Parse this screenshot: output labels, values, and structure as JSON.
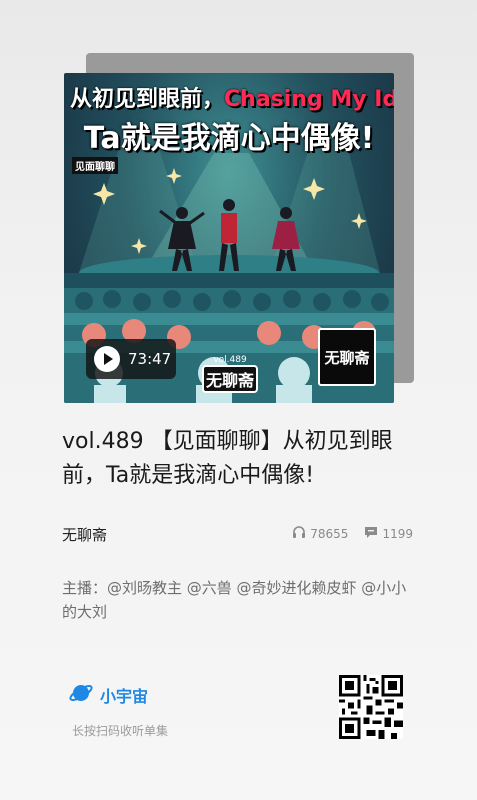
{
  "cover": {
    "title_line1_prefix": "从初见到眼前，",
    "title_line1_accent": "Chasing My Idol",
    "title_line2": "Ta就是我滴心中偶像!",
    "brand_small": "见面聊聊",
    "duration": "73:47",
    "vol_label": "vol.489",
    "vol_logo_name": "无聊斋",
    "corner_logo_name": "无聊斋"
  },
  "episode": {
    "title": "vol.489 【见面聊聊】从初见到眼前，Ta就是我滴心中偶像!",
    "show_name": "无聊斋",
    "plays": "78655",
    "comments": "1199",
    "hosts": "主播：@刘旸教主 @六兽 @奇妙进化赖皮虾 @小小的大刘"
  },
  "footer": {
    "brand": "小宇宙",
    "scan_hint": "长按扫码收听单集"
  },
  "colors": {
    "accent_blue": "#1f88e5",
    "cover_red": "#ff2a55"
  },
  "icons": {
    "plays": "headphones-icon",
    "comments": "comment-icon",
    "play": "play-icon",
    "brand": "planet-icon"
  }
}
